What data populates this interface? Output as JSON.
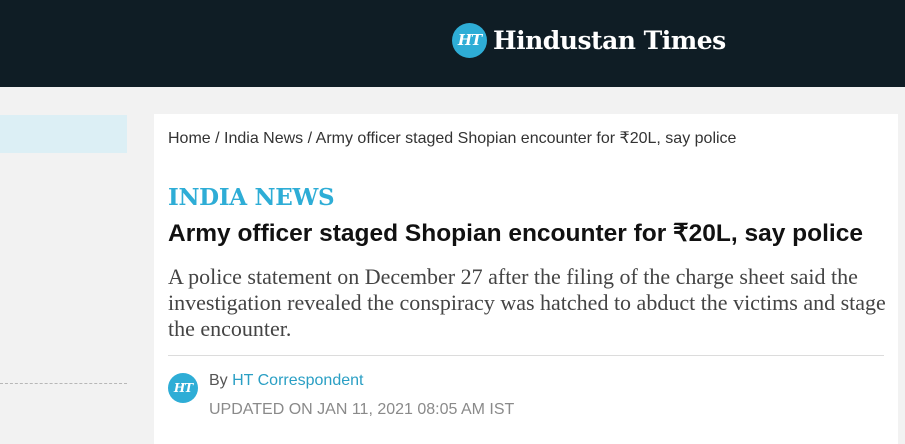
{
  "header": {
    "logo_badge": "HT",
    "logo_text": "Hindustan Times",
    "background_color": "#0f1d25",
    "brand_color": "#2eadd6"
  },
  "breadcrumb": {
    "items": [
      "Home",
      "India News",
      "Army officer staged Shopian encounter for ₹20L, say police"
    ],
    "separator": "/"
  },
  "article": {
    "section": "INDIA NEWS",
    "headline": "Army officer staged Shopian encounter for ₹20L, say police",
    "summary": "A police statement on December 27 after the filing of the charge sheet said the investigation revealed the conspiracy was hatched to abduct the victims and stage the encounter.",
    "author": {
      "avatar_badge": "HT",
      "by_label": "By",
      "name": "HT Correspondent"
    },
    "updated": "UPDATED ON JAN 11, 2021 08:05 AM IST"
  }
}
